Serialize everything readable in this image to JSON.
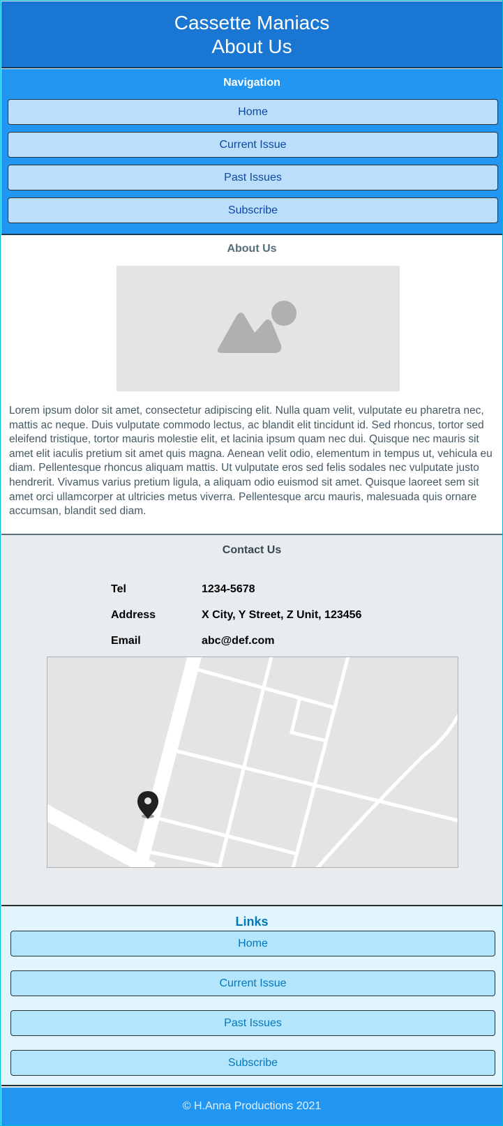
{
  "header": {
    "site_title": "Cassette Maniacs",
    "page_title": "About Us"
  },
  "nav": {
    "title": "Navigation",
    "items": [
      {
        "label": "Home"
      },
      {
        "label": "Current Issue"
      },
      {
        "label": "Past Issues"
      },
      {
        "label": "Subscribe"
      }
    ]
  },
  "about": {
    "title": "About Us",
    "image_icon": "image-placeholder-icon",
    "text": "Lorem ipsum dolor sit amet, consectetur adipiscing elit. Nulla quam velit, vulputate eu pharetra nec, mattis ac neque. Duis vulputate commodo lectus, ac blandit elit tincidunt id. Sed rhoncus, tortor sed eleifend tristique, tortor mauris molestie elit, et lacinia ipsum quam nec dui. Quisque nec mauris sit amet elit iaculis pretium sit amet quis magna. Aenean velit odio, elementum in tempus ut, vehicula eu diam. Pellentesque rhoncus aliquam mattis. Ut vulputate eros sed felis sodales nec vulputate justo hendrerit. Vivamus varius pretium ligula, a aliquam odio euismod sit amet. Quisque laoreet sem sit amet orci ullamcorper at ultricies metus viverra. Pellentesque arcu mauris, malesuada quis ornare accumsan, blandit sed diam."
  },
  "contact": {
    "title": "Contact Us",
    "rows": [
      {
        "label": "Tel",
        "value": "1234-5678"
      },
      {
        "label": "Address",
        "value": "X City, Y Street, Z Unit, 123456"
      },
      {
        "label": "Email",
        "value": "abc@def.com"
      }
    ],
    "map_icon": "map-pin-icon"
  },
  "links": {
    "title": "Links",
    "items": [
      {
        "label": "Home"
      },
      {
        "label": "Current Issue"
      },
      {
        "label": "Past Issues"
      },
      {
        "label": "Subscribe"
      }
    ]
  },
  "footer": {
    "text": "© H.Anna Productions 2021"
  },
  "colors": {
    "header_bg": "#1976d2",
    "nav_bg": "#2196f3",
    "nav_button_bg": "#bbdefb",
    "links_bg": "#e1f5fe",
    "links_button_bg": "#b3e5fc",
    "footer_bg": "#2196f3"
  }
}
